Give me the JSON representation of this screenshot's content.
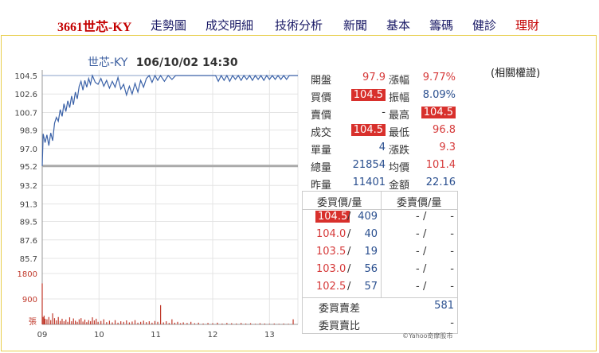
{
  "nav": {
    "stock_name": "3661世芯-KY",
    "links": [
      "走勢圖",
      "成交明細",
      "技術分析",
      "新聞",
      "基本",
      "籌碼",
      "健診",
      "理財"
    ]
  },
  "chart_title": {
    "name": "世芯-KY",
    "datetime": "106/10/02 14:30"
  },
  "chart_data": {
    "type": "line",
    "price_axis": {
      "ticks": [
        "104.5",
        "102.6",
        "100.7",
        "98.9",
        "97.0",
        "95.2",
        "93.2",
        "91.3",
        "89.5",
        "87.6",
        "85.7"
      ],
      "ylim": [
        85.7,
        104.5
      ],
      "reference": 95.2
    },
    "volume_axis": {
      "ticks": [
        "1800",
        "900"
      ],
      "unit_label": "張",
      "ylim": [
        0,
        1800
      ]
    },
    "x_ticks": [
      "09",
      "10",
      "11",
      "12",
      "13"
    ],
    "colors": {
      "price_line": "#3b62a8",
      "volume_bars": "#c0392b",
      "reference_line": "#aaaaaa"
    },
    "price_series": [
      {
        "t": "09:00",
        "v": 95.2
      },
      {
        "t": "09:01",
        "v": 98.5
      },
      {
        "t": "09:03",
        "v": 97.6
      },
      {
        "t": "09:05",
        "v": 98.4
      },
      {
        "t": "09:07",
        "v": 97.3
      },
      {
        "t": "09:09",
        "v": 98.6
      },
      {
        "t": "09:11",
        "v": 97.8
      },
      {
        "t": "09:13",
        "v": 99.6
      },
      {
        "t": "09:15",
        "v": 100.2
      },
      {
        "t": "09:17",
        "v": 99.8
      },
      {
        "t": "09:19",
        "v": 101.0
      },
      {
        "t": "09:21",
        "v": 100.3
      },
      {
        "t": "09:23",
        "v": 101.6
      },
      {
        "t": "09:25",
        "v": 100.8
      },
      {
        "t": "09:27",
        "v": 101.9
      },
      {
        "t": "09:29",
        "v": 101.2
      },
      {
        "t": "09:31",
        "v": 102.4
      },
      {
        "t": "09:33",
        "v": 101.5
      },
      {
        "t": "09:35",
        "v": 102.8
      },
      {
        "t": "09:37",
        "v": 102.1
      },
      {
        "t": "09:39",
        "v": 103.4
      },
      {
        "t": "09:41",
        "v": 103.9
      },
      {
        "t": "09:43",
        "v": 103.0
      },
      {
        "t": "09:45",
        "v": 104.0
      },
      {
        "t": "09:47",
        "v": 103.3
      },
      {
        "t": "09:49",
        "v": 104.2
      },
      {
        "t": "09:51",
        "v": 103.6
      },
      {
        "t": "09:53",
        "v": 104.5
      },
      {
        "t": "09:56",
        "v": 103.8
      },
      {
        "t": "09:59",
        "v": 103.6
      },
      {
        "t": "10:02",
        "v": 104.2
      },
      {
        "t": "10:05",
        "v": 103.4
      },
      {
        "t": "10:08",
        "v": 104.0
      },
      {
        "t": "10:11",
        "v": 103.2
      },
      {
        "t": "10:14",
        "v": 103.9
      },
      {
        "t": "10:17",
        "v": 103.3
      },
      {
        "t": "10:20",
        "v": 104.3
      },
      {
        "t": "10:23",
        "v": 103.1
      },
      {
        "t": "10:26",
        "v": 103.6
      },
      {
        "t": "10:29",
        "v": 102.5
      },
      {
        "t": "10:32",
        "v": 103.4
      },
      {
        "t": "10:35",
        "v": 102.6
      },
      {
        "t": "10:38",
        "v": 103.7
      },
      {
        "t": "10:41",
        "v": 102.8
      },
      {
        "t": "10:44",
        "v": 104.0
      },
      {
        "t": "10:47",
        "v": 103.3
      },
      {
        "t": "10:50",
        "v": 104.2
      },
      {
        "t": "10:53",
        "v": 104.5
      },
      {
        "t": "10:56",
        "v": 103.8
      },
      {
        "t": "10:59",
        "v": 104.5
      },
      {
        "t": "11:02",
        "v": 104.0
      },
      {
        "t": "11:05",
        "v": 104.5
      },
      {
        "t": "11:09",
        "v": 103.9
      },
      {
        "t": "11:13",
        "v": 104.5
      },
      {
        "t": "11:17",
        "v": 104.1
      },
      {
        "t": "11:21",
        "v": 104.5
      },
      {
        "t": "11:25",
        "v": 104.5
      },
      {
        "t": "11:29",
        "v": 104.5
      },
      {
        "t": "11:33",
        "v": 104.5
      },
      {
        "t": "11:37",
        "v": 104.5
      },
      {
        "t": "11:41",
        "v": 104.5
      },
      {
        "t": "11:45",
        "v": 104.5
      },
      {
        "t": "11:49",
        "v": 104.5
      },
      {
        "t": "11:53",
        "v": 104.5
      },
      {
        "t": "11:57",
        "v": 104.5
      },
      {
        "t": "12:00",
        "v": 104.5
      },
      {
        "t": "12:03",
        "v": 104.5
      },
      {
        "t": "12:06",
        "v": 103.9
      },
      {
        "t": "12:09",
        "v": 104.5
      },
      {
        "t": "12:12",
        "v": 104.0
      },
      {
        "t": "12:15",
        "v": 104.5
      },
      {
        "t": "12:18",
        "v": 103.9
      },
      {
        "t": "12:21",
        "v": 104.5
      },
      {
        "t": "12:24",
        "v": 104.1
      },
      {
        "t": "12:27",
        "v": 104.5
      },
      {
        "t": "12:30",
        "v": 104.0
      },
      {
        "t": "12:33",
        "v": 104.5
      },
      {
        "t": "12:36",
        "v": 104.1
      },
      {
        "t": "12:39",
        "v": 104.5
      },
      {
        "t": "12:42",
        "v": 104.0
      },
      {
        "t": "12:45",
        "v": 104.5
      },
      {
        "t": "12:48",
        "v": 104.1
      },
      {
        "t": "12:51",
        "v": 104.5
      },
      {
        "t": "12:54",
        "v": 104.0
      },
      {
        "t": "12:57",
        "v": 104.5
      },
      {
        "t": "13:00",
        "v": 104.1
      },
      {
        "t": "13:03",
        "v": 104.5
      },
      {
        "t": "13:06",
        "v": 104.1
      },
      {
        "t": "13:09",
        "v": 104.5
      },
      {
        "t": "13:12",
        "v": 104.1
      },
      {
        "t": "13:15",
        "v": 104.5
      },
      {
        "t": "13:18",
        "v": 104.1
      },
      {
        "t": "13:21",
        "v": 104.5
      },
      {
        "t": "13:24",
        "v": 104.5
      },
      {
        "t": "13:27",
        "v": 104.5
      },
      {
        "t": "13:30",
        "v": 104.5
      }
    ],
    "volume_series": [
      {
        "t": "09:00",
        "v": 1450
      },
      {
        "t": "09:01",
        "v": 260
      },
      {
        "t": "09:02",
        "v": 310
      },
      {
        "t": "09:03",
        "v": 200
      },
      {
        "t": "09:05",
        "v": 180
      },
      {
        "t": "09:07",
        "v": 260
      },
      {
        "t": "09:09",
        "v": 150
      },
      {
        "t": "09:11",
        "v": 390
      },
      {
        "t": "09:13",
        "v": 220
      },
      {
        "t": "09:15",
        "v": 140
      },
      {
        "t": "09:17",
        "v": 260
      },
      {
        "t": "09:19",
        "v": 120
      },
      {
        "t": "09:21",
        "v": 200
      },
      {
        "t": "09:23",
        "v": 110
      },
      {
        "t": "09:25",
        "v": 170
      },
      {
        "t": "09:27",
        "v": 90
      },
      {
        "t": "09:29",
        "v": 250
      },
      {
        "t": "09:31",
        "v": 110
      },
      {
        "t": "09:33",
        "v": 210
      },
      {
        "t": "09:35",
        "v": 130
      },
      {
        "t": "09:37",
        "v": 90
      },
      {
        "t": "09:39",
        "v": 180
      },
      {
        "t": "09:41",
        "v": 220
      },
      {
        "t": "09:43",
        "v": 100
      },
      {
        "t": "09:45",
        "v": 170
      },
      {
        "t": "09:47",
        "v": 80
      },
      {
        "t": "09:49",
        "v": 150
      },
      {
        "t": "09:51",
        "v": 110
      },
      {
        "t": "09:53",
        "v": 250
      },
      {
        "t": "09:55",
        "v": 140
      },
      {
        "t": "09:57",
        "v": 200
      },
      {
        "t": "09:59",
        "v": 90
      },
      {
        "t": "10:02",
        "v": 120
      },
      {
        "t": "10:05",
        "v": 180
      },
      {
        "t": "10:08",
        "v": 80
      },
      {
        "t": "10:11",
        "v": 130
      },
      {
        "t": "10:14",
        "v": 70
      },
      {
        "t": "10:17",
        "v": 150
      },
      {
        "t": "10:20",
        "v": 60
      },
      {
        "t": "10:23",
        "v": 110
      },
      {
        "t": "10:26",
        "v": 90
      },
      {
        "t": "10:29",
        "v": 140
      },
      {
        "t": "10:32",
        "v": 70
      },
      {
        "t": "10:35",
        "v": 100
      },
      {
        "t": "10:38",
        "v": 150
      },
      {
        "t": "10:41",
        "v": 60
      },
      {
        "t": "10:44",
        "v": 90
      },
      {
        "t": "10:47",
        "v": 130
      },
      {
        "t": "10:50",
        "v": 80
      },
      {
        "t": "10:53",
        "v": 110
      },
      {
        "t": "10:56",
        "v": 60
      },
      {
        "t": "10:59",
        "v": 120
      },
      {
        "t": "11:02",
        "v": 90
      },
      {
        "t": "11:05",
        "v": 680
      },
      {
        "t": "11:08",
        "v": 70
      },
      {
        "t": "11:11",
        "v": 110
      },
      {
        "t": "11:14",
        "v": 50
      },
      {
        "t": "11:17",
        "v": 180
      },
      {
        "t": "11:20",
        "v": 60
      },
      {
        "t": "11:23",
        "v": 90
      },
      {
        "t": "11:26",
        "v": 40
      },
      {
        "t": "11:29",
        "v": 70
      },
      {
        "t": "11:33",
        "v": 50
      },
      {
        "t": "11:37",
        "v": 90
      },
      {
        "t": "11:41",
        "v": 40
      },
      {
        "t": "11:45",
        "v": 60
      },
      {
        "t": "11:50",
        "v": 30
      },
      {
        "t": "11:55",
        "v": 50
      },
      {
        "t": "12:00",
        "v": 40
      },
      {
        "t": "12:05",
        "v": 60
      },
      {
        "t": "12:10",
        "v": 30
      },
      {
        "t": "12:15",
        "v": 50
      },
      {
        "t": "12:20",
        "v": 40
      },
      {
        "t": "12:25",
        "v": 30
      },
      {
        "t": "12:30",
        "v": 50
      },
      {
        "t": "12:35",
        "v": 30
      },
      {
        "t": "12:40",
        "v": 40
      },
      {
        "t": "12:45",
        "v": 20
      },
      {
        "t": "12:50",
        "v": 40
      },
      {
        "t": "12:55",
        "v": 30
      },
      {
        "t": "13:00",
        "v": 20
      },
      {
        "t": "13:05",
        "v": 30
      },
      {
        "t": "13:10",
        "v": 20
      },
      {
        "t": "13:15",
        "v": 30
      },
      {
        "t": "13:20",
        "v": 20
      },
      {
        "t": "13:25",
        "v": 180
      }
    ]
  },
  "quote": {
    "rows": [
      {
        "l1": "開盤",
        "v1": "97.9",
        "l2": "漲幅",
        "v2": "9.77%"
      },
      {
        "l1": "買價",
        "v1": "104.5",
        "l2": "振幅",
        "v2": "8.09%"
      },
      {
        "l1": "賣價",
        "v1": "-",
        "l2": "最高",
        "v2": "104.5"
      },
      {
        "l1": "成交",
        "v1": "104.5",
        "l2": "最低",
        "v2": "96.8"
      },
      {
        "l1": "單量",
        "v1": "4",
        "l2": "漲跌",
        "v2": "9.3"
      },
      {
        "l1": "總量",
        "v1": "21854",
        "l2": "均價",
        "v2": "101.4"
      },
      {
        "l1": "昨量",
        "v1": "11401",
        "l2": "金額",
        "v2": "22.16"
      }
    ]
  },
  "order_book": {
    "bid_header": "委買價/量",
    "ask_header": "委賣價/量",
    "rows": [
      {
        "bid_price": "104.5",
        "bid_qty": "409",
        "ask_price": "-",
        "ask_qty": "-"
      },
      {
        "bid_price": "104.0",
        "bid_qty": "40",
        "ask_price": "-",
        "ask_qty": "-"
      },
      {
        "bid_price": "103.5",
        "bid_qty": "19",
        "ask_price": "-",
        "ask_qty": "-"
      },
      {
        "bid_price": "103.0",
        "bid_qty": "56",
        "ask_price": "-",
        "ask_qty": "-"
      },
      {
        "bid_price": "102.5",
        "bid_qty": "57",
        "ask_price": "-",
        "ask_qty": "-"
      }
    ],
    "diff_label": "委買賣差",
    "diff_value": "581",
    "ratio_label": "委買賣比",
    "ratio_value": "-"
  },
  "related_label": "(相關權證)",
  "credit": "©Yahoo奇摩股市"
}
